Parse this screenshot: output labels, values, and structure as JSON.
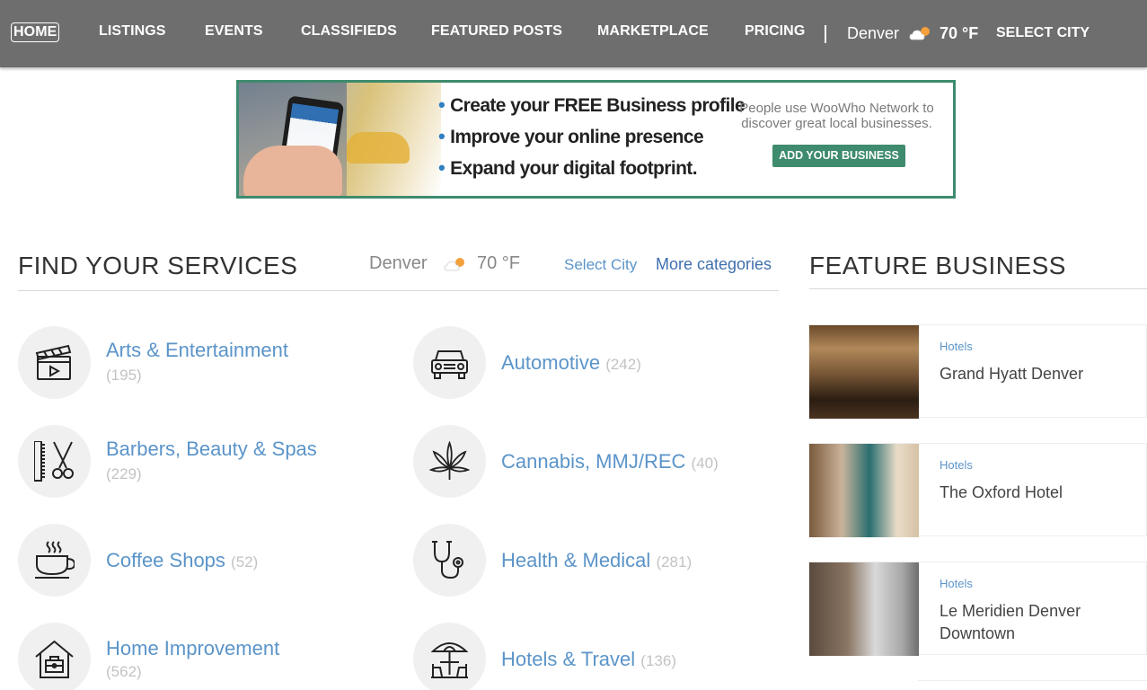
{
  "nav": {
    "items": [
      "HOME",
      "LISTINGS",
      "EVENTS",
      "CLASSIFIEDS",
      "FEATURED POSTS",
      "MARKETPLACE",
      "PRICING"
    ],
    "city": "Denver",
    "weather_icon": "partly-cloudy-icon",
    "temp": "70 °F",
    "select_city": "SELECT CITY"
  },
  "banner": {
    "bullets": [
      "Create your FREE Business profile",
      "Improve your online presence",
      "Expand your digital footprint."
    ],
    "tagline": "People use WooWho Network to discover great local businesses.",
    "cta": "ADD YOUR BUSINESS"
  },
  "services": {
    "title": "FIND YOUR SERVICES",
    "city": "Denver",
    "weather_icon": "partly-cloudy-icon",
    "temp": "70 °F",
    "select_city": "Select City",
    "more_categories": "More categories",
    "categories": [
      {
        "name": "Arts & Entertainment",
        "count": "(195)",
        "icon": "clapperboard-icon"
      },
      {
        "name": "Automotive",
        "count": "(242)",
        "icon": "jeep-icon"
      },
      {
        "name": "Barbers, Beauty & Spas",
        "count": "(229)",
        "icon": "comb-scissors-icon"
      },
      {
        "name": "Cannabis, MMJ/REC",
        "count": "(40)",
        "icon": "cannabis-leaf-icon"
      },
      {
        "name": "Coffee Shops",
        "count": "(52)",
        "icon": "coffee-cup-icon"
      },
      {
        "name": "Health & Medical",
        "count": "(281)",
        "icon": "stethoscope-icon"
      },
      {
        "name": "Home Improvement",
        "count": "(562)",
        "icon": "house-toolbox-icon"
      },
      {
        "name": "Hotels & Travel",
        "count": "(136)",
        "icon": "beach-umbrella-icon"
      }
    ]
  },
  "featured": {
    "title": "FEATURE BUSINESS",
    "items": [
      {
        "category": "Hotels",
        "name": "Grand Hyatt Denver"
      },
      {
        "category": "Hotels",
        "name": "The Oxford Hotel"
      },
      {
        "category": "Hotels",
        "name": "Le Meridien Denver Downtown"
      }
    ]
  },
  "colors": {
    "nav_bg": "#6e6e6e",
    "link_blue": "#5b94c9",
    "banner_green": "#3e8b6e",
    "count_gray": "#c3c3c3"
  }
}
